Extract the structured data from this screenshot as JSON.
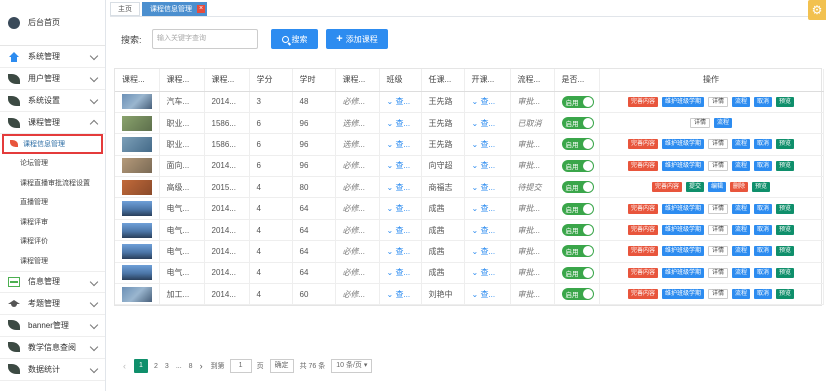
{
  "sidebar": {
    "home": "后台首页",
    "menus": [
      {
        "label": "系统管理"
      },
      {
        "label": "用户管理"
      },
      {
        "label": "系统设置"
      },
      {
        "label": "课程管理"
      }
    ],
    "course_sub": [
      {
        "label": "课程信息管理"
      },
      {
        "label": "论坛管理"
      },
      {
        "label": "课程直播审批流程设置"
      },
      {
        "label": "直播管理"
      },
      {
        "label": "课程评审"
      },
      {
        "label": "课程评价"
      },
      {
        "label": "课程管理"
      }
    ],
    "menus_bottom": [
      {
        "label": "信息管理"
      },
      {
        "label": "考题管理"
      },
      {
        "label": "banner管理"
      },
      {
        "label": "教学信息查阅"
      },
      {
        "label": "数据统计"
      }
    ]
  },
  "tabs": [
    {
      "label": "主页"
    },
    {
      "label": "课程信息管理",
      "close": "×"
    }
  ],
  "search": {
    "label": "搜索:",
    "placeholder": "输入关键字查询",
    "search_button": "搜索",
    "add_button": "添加课程"
  },
  "table": {
    "headers": [
      "课程...",
      "课程...",
      "课程...",
      "学分",
      "学时",
      "课程...",
      "班级",
      "任课...",
      "开课...",
      "流程...",
      "是否...",
      "操作"
    ],
    "rows": [
      {
        "name": "汽车...",
        "code": "2014...",
        "credit": "3",
        "hours": "48",
        "type": "必修...",
        "class": "查...",
        "teacher": "王先路",
        "open": "查...",
        "flow": "审批...",
        "status": "启用",
        "ops": [
          "完善内容",
          "维护班级学期",
          "详情",
          "流程",
          "取消",
          "预览"
        ]
      },
      {
        "name": "职业...",
        "code": "1586...",
        "credit": "6",
        "hours": "96",
        "type": "选修...",
        "class": "查...",
        "teacher": "王先路",
        "open": "查...",
        "flow": "已取消",
        "status": "启用",
        "ops": [
          "详情",
          "流程"
        ]
      },
      {
        "name": "职业...",
        "code": "1586...",
        "credit": "6",
        "hours": "96",
        "type": "选修...",
        "class": "查...",
        "teacher": "王先路",
        "open": "查...",
        "flow": "审批...",
        "status": "启用",
        "ops": [
          "完善内容",
          "维护班级学期",
          "详情",
          "流程",
          "取消",
          "预览"
        ]
      },
      {
        "name": "面向...",
        "code": "2014...",
        "credit": "6",
        "hours": "96",
        "type": "必修...",
        "class": "查...",
        "teacher": "向守超",
        "open": "查...",
        "flow": "审批...",
        "status": "启用",
        "ops": [
          "完善内容",
          "维护班级学期",
          "详情",
          "流程",
          "取消",
          "预览"
        ]
      },
      {
        "name": "高级...",
        "code": "2015...",
        "credit": "4",
        "hours": "80",
        "type": "必修...",
        "class": "查...",
        "teacher": "商福志",
        "open": "查...",
        "flow": "待提交",
        "status": "启用",
        "ops": [
          "完善内容",
          "提交",
          "编辑",
          "删除",
          "预览"
        ]
      },
      {
        "name": "电气...",
        "code": "2014...",
        "credit": "4",
        "hours": "64",
        "type": "必修...",
        "class": "查...",
        "teacher": "成茜",
        "open": "查...",
        "flow": "审批...",
        "status": "启用",
        "ops": [
          "完善内容",
          "维护班级学期",
          "详情",
          "流程",
          "取消",
          "预览"
        ]
      },
      {
        "name": "电气...",
        "code": "2014...",
        "credit": "4",
        "hours": "64",
        "type": "必修...",
        "class": "查...",
        "teacher": "成茜",
        "open": "查...",
        "flow": "审批...",
        "status": "启用",
        "ops": [
          "完善内容",
          "维护班级学期",
          "详情",
          "流程",
          "取消",
          "预览"
        ]
      },
      {
        "name": "电气...",
        "code": "2014...",
        "credit": "4",
        "hours": "64",
        "type": "必修...",
        "class": "查...",
        "teacher": "成茜",
        "open": "查...",
        "flow": "审批...",
        "status": "启用",
        "ops": [
          "完善内容",
          "维护班级学期",
          "详情",
          "流程",
          "取消",
          "预览"
        ]
      },
      {
        "name": "电气...",
        "code": "2014...",
        "credit": "4",
        "hours": "64",
        "type": "必修...",
        "class": "查...",
        "teacher": "成茜",
        "open": "查...",
        "flow": "审批...",
        "status": "启用",
        "ops": [
          "完善内容",
          "维护班级学期",
          "详情",
          "流程",
          "取消",
          "预览"
        ]
      },
      {
        "name": "加工...",
        "code": "2014...",
        "credit": "4",
        "hours": "60",
        "type": "必修...",
        "class": "查...",
        "teacher": "刘艳中",
        "open": "查...",
        "flow": "审批...",
        "status": "启用",
        "ops": [
          "完善内容",
          "维护班级学期",
          "详情",
          "流程",
          "取消",
          "预览"
        ]
      }
    ]
  },
  "pager": {
    "pages": [
      "1",
      "2",
      "3",
      "...",
      "8"
    ],
    "goto_label": "到第",
    "goto_value": "1",
    "page_unit": "页",
    "confirm": "确定",
    "total": "共 76 条",
    "page_size": "10 条/页 ▾"
  },
  "colors": {
    "accent": "#2d8cf0",
    "green": "#0f8f6b",
    "red": "#e8553c",
    "highlight": "#e43b3b"
  }
}
